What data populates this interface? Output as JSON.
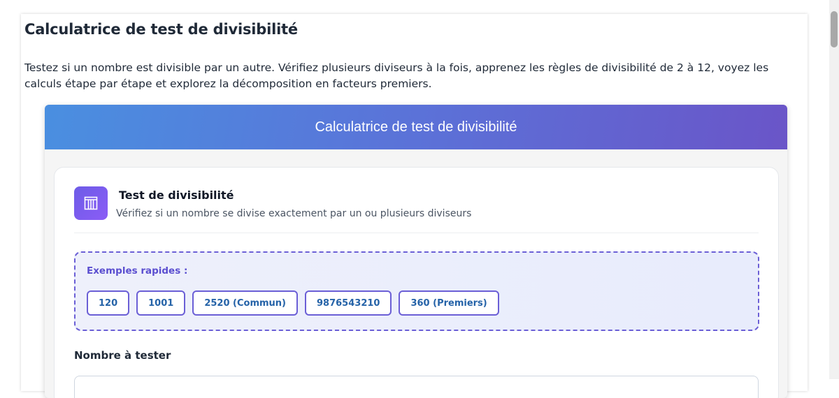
{
  "page": {
    "title": "Calculatrice de test de divisibilité",
    "description": "Testez si un nombre est divisible par un autre. Vérifiez plusieurs diviseurs à la fois, apprenez les règles de divisibilité de 2 à 12, voyez les calculs étape par étape et explorez la décomposition en facteurs premiers."
  },
  "widget": {
    "header_title": "Calculatrice de test de divisibilité",
    "card": {
      "icon": "divider-grid-icon",
      "title": "Test de divisibilité",
      "subtitle": "Vérifiez si un nombre se divise exactement par un ou plusieurs diviseurs"
    },
    "examples": {
      "label": "Exemples rapides :",
      "chips": [
        "120",
        "1001",
        "2520 (Commun)",
        "9876543210",
        "360 (Premiers)"
      ]
    },
    "number_field": {
      "label": "Nombre à tester",
      "value": "",
      "placeholder": ""
    }
  },
  "colors": {
    "header_gradient_start": "#4a8fe0",
    "header_gradient_end": "#6a55c8",
    "accent": "#6b5fd6",
    "chip_text": "#2563a8"
  }
}
